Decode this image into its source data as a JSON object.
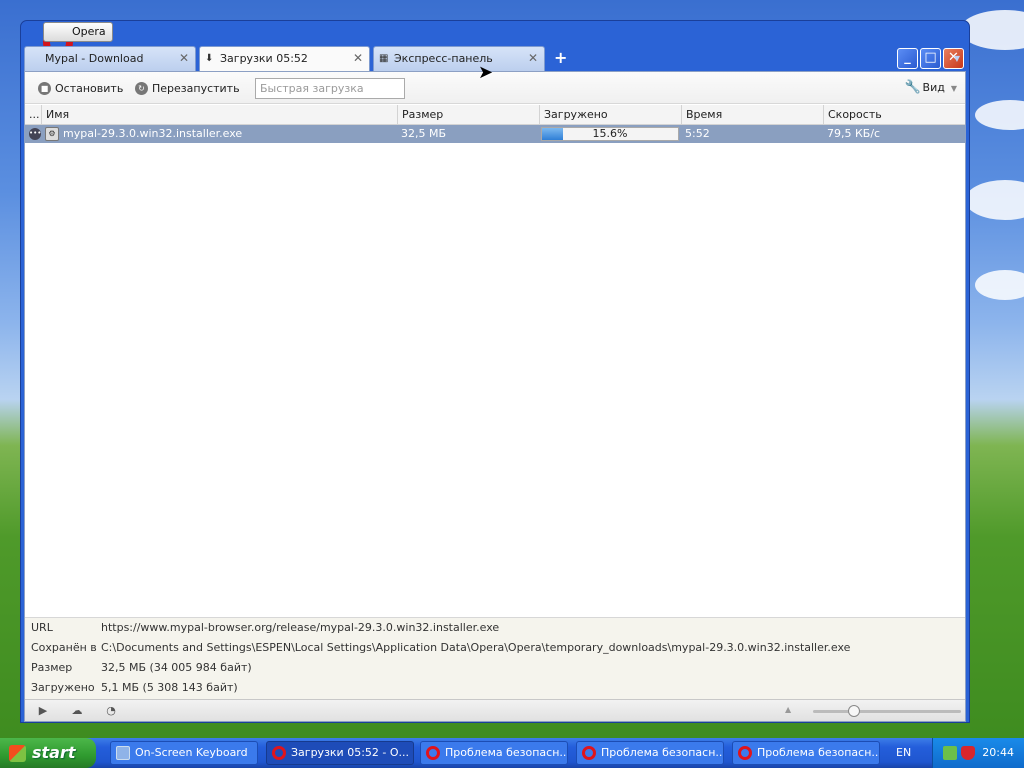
{
  "window": {
    "opera_menu_label": "Opera",
    "tabs": [
      {
        "label": "Mypal - Download",
        "close": "✕"
      },
      {
        "label": "Загрузки 05:52",
        "close": "✕"
      },
      {
        "label": "Экспресс-панель",
        "close": "✕"
      }
    ],
    "new_tab": "+"
  },
  "toolbar": {
    "stop_label": "Остановить",
    "restart_label": "Перезапустить",
    "quick_download_placeholder": "Быстрая загрузка",
    "view_label": "Вид"
  },
  "columns": {
    "menu": "...",
    "name": "Имя",
    "size": "Размер",
    "downloaded": "Загружено",
    "time": "Время",
    "speed": "Скорость"
  },
  "downloads": [
    {
      "name": "mypal-29.3.0.win32.installer.exe",
      "size": "32,5 МБ",
      "progress_text": "15.6%",
      "progress": 0.156,
      "time": "5:52",
      "speed": "79,5 КБ/с"
    }
  ],
  "details": {
    "url_label": "URL",
    "url_value": "https://www.mypal-browser.org/release/mypal-29.3.0.win32.installer.exe",
    "saved_label": "Сохранён в",
    "saved_value": "C:\\Documents and Settings\\ESPEN\\Local Settings\\Application Data\\Opera\\Opera\\temporary_downloads\\mypal-29.3.0.win32.installer.exe",
    "size_label": "Размер",
    "size_value": "32,5 МБ (34 005 984 байт)",
    "downloaded_label": "Загружено",
    "downloaded_value": "5,1 МБ (5 308 143 байт)"
  },
  "taskbar": {
    "start_label": "start",
    "tasks": [
      {
        "label": "On-Screen Keyboard"
      },
      {
        "label": "Загрузки 05:52 - О..."
      },
      {
        "label": "Проблема безопасн..."
      },
      {
        "label": "Проблема безопасн..."
      },
      {
        "label": "Проблема безопасн..."
      }
    ],
    "language": "EN",
    "clock": "20:44"
  },
  "colors": {
    "selected_row": "#8a9fc0",
    "window_frame": "#2b63d6",
    "progress_fill": "#2f7fd6"
  }
}
